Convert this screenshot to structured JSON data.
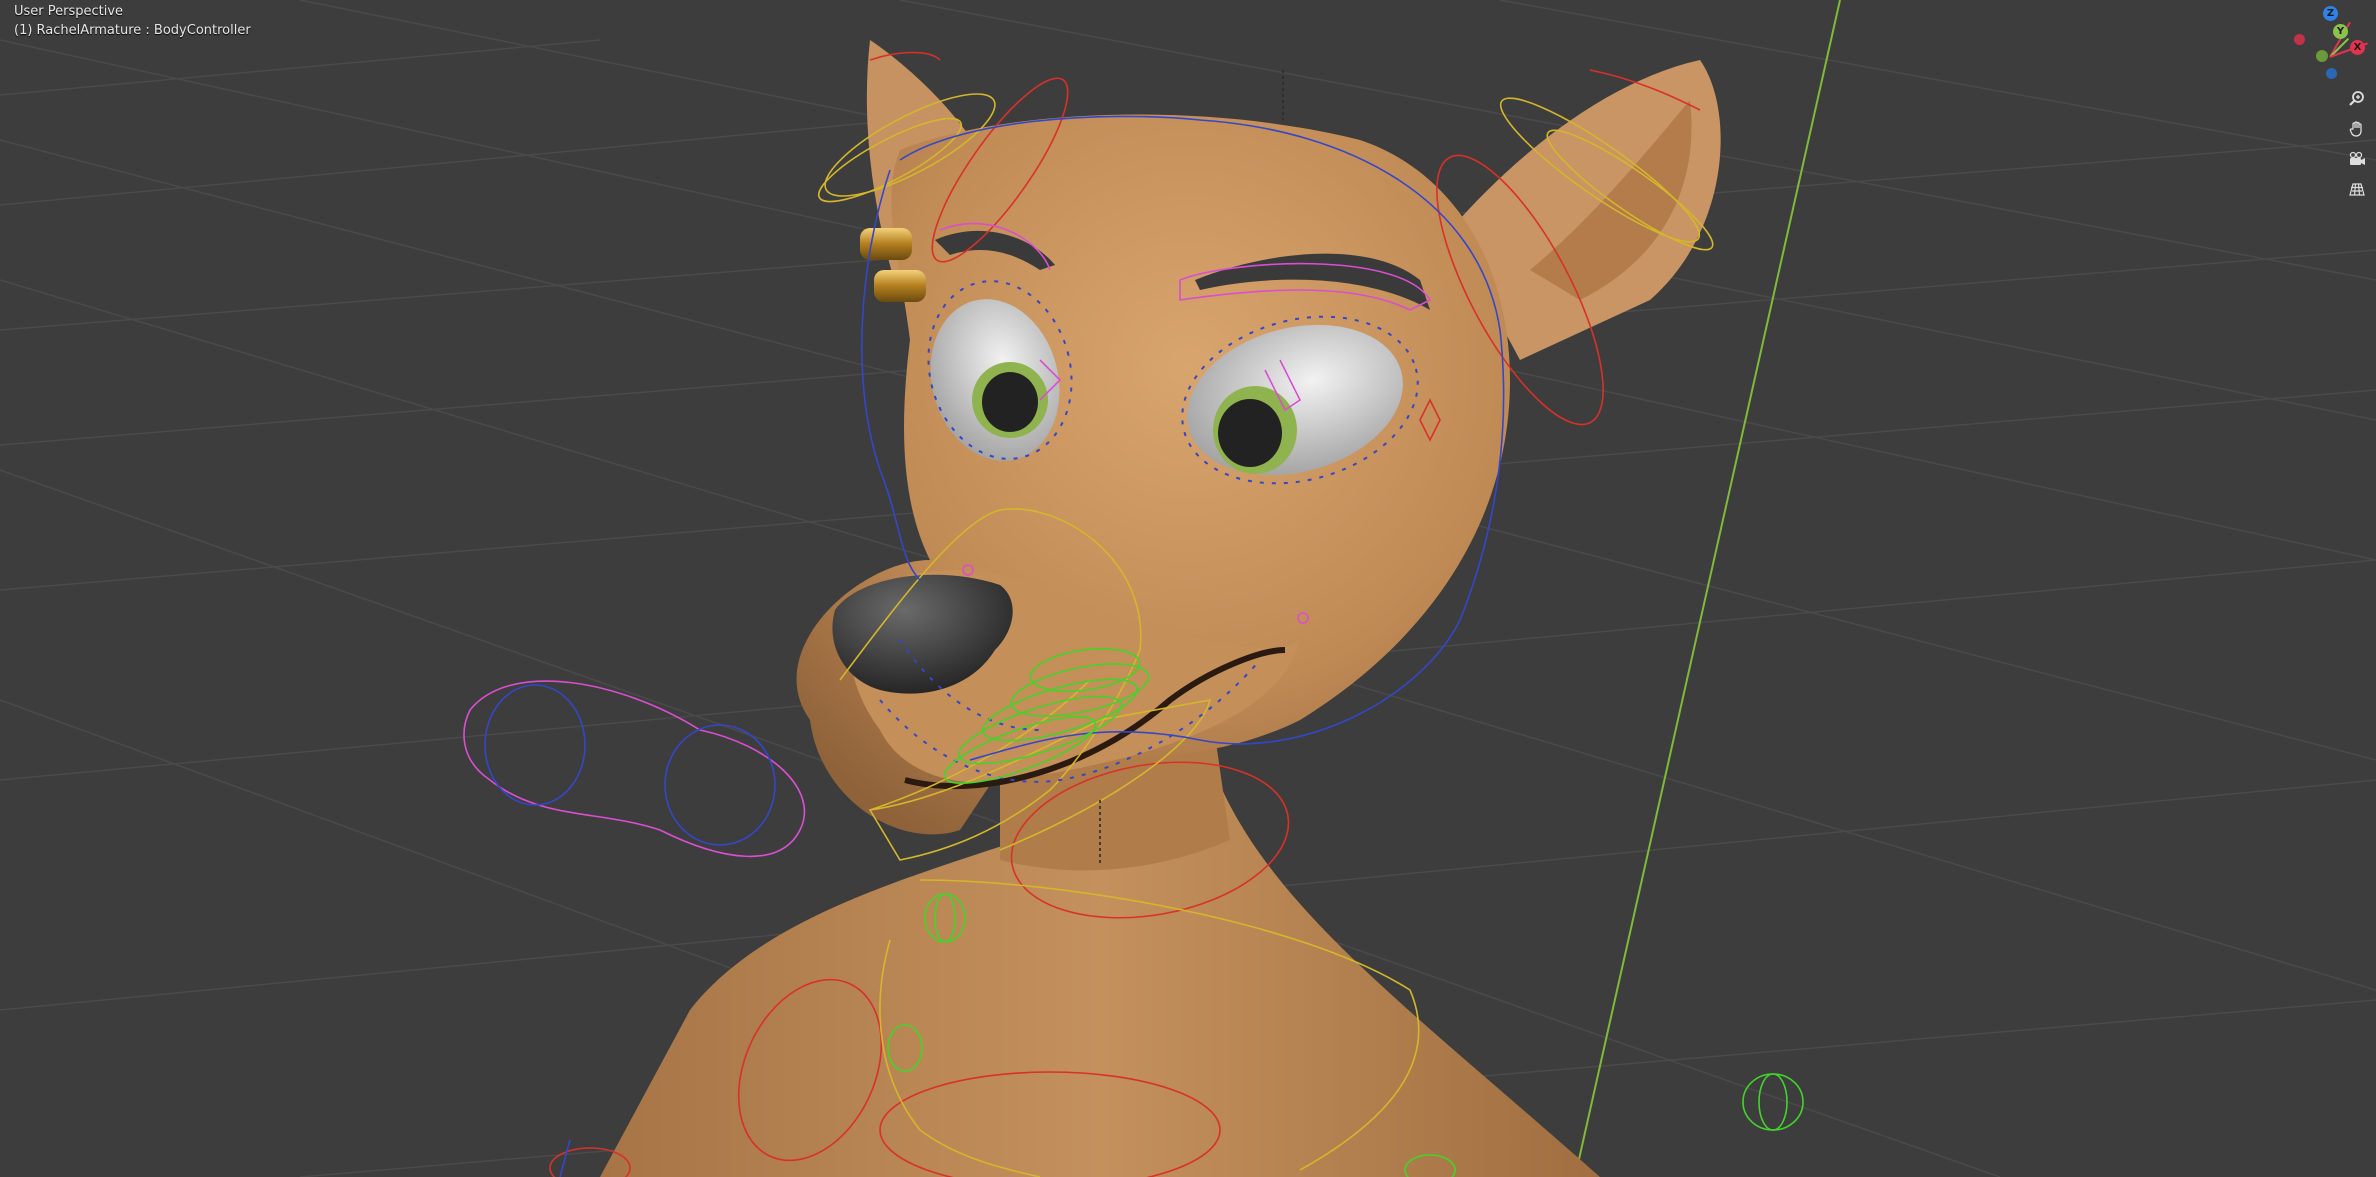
{
  "viewport": {
    "view_title": "User Perspective",
    "active_object": "(1) RachelArmature : BodyController"
  },
  "gizmo": {
    "axes": [
      {
        "label": "Z",
        "color": "#2f83e6"
      },
      {
        "label": "Y",
        "color": "#8bc34a"
      },
      {
        "label": "X",
        "color": "#e0334d"
      }
    ],
    "negative_colors": [
      "#c2334a",
      "#6a9a3a",
      "#2a67b5"
    ]
  },
  "nav_tools": [
    {
      "name": "zoom-icon"
    },
    {
      "name": "pan-hand-icon"
    },
    {
      "name": "camera-view-icon"
    },
    {
      "name": "grid-view-icon"
    }
  ],
  "colors": {
    "background": "#3d3d3d",
    "grid": "#4a4a4a",
    "skin": "#c38f5c",
    "bone_red": "#d8312a",
    "bone_yellow": "#d4b62c",
    "bone_magenta": "#d94fd0",
    "bone_blue": "#3447c9",
    "bone_green": "#43d42a",
    "axis_y": "#7fba3a"
  }
}
